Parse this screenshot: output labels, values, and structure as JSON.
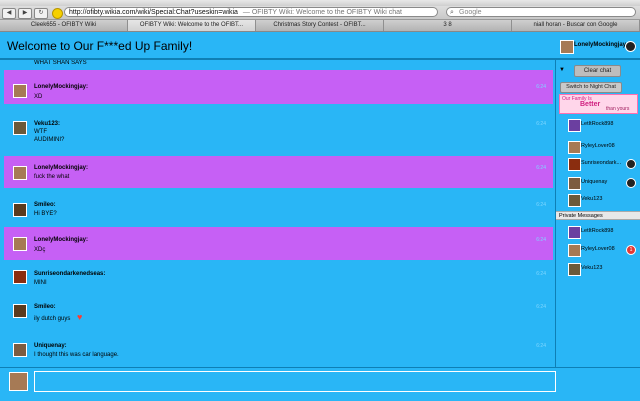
{
  "browser": {
    "url": "http://ofibty.wikia.com/wiki/Special:Chat?useskin=wikia",
    "page_title": "— OFIBTY Wiki: Welcome to the OFIBTY Wiki chat",
    "search_placeholder": "Google",
    "nav": {
      "back": "◀",
      "forward": "▶",
      "refresh": "↻",
      "stop": "+"
    },
    "tabs": [
      {
        "label": "Cleek655 - OFIBTY Wiki"
      },
      {
        "label": "OFIBTY Wiki: Welcome to the OFIBT..."
      },
      {
        "label": "Christmas Story Contest - OFIBT..."
      },
      {
        "label": "3 8"
      },
      {
        "label": "niall horan - Buscar con Google"
      }
    ]
  },
  "chat": {
    "title": "Welcome to Our F***ed Up Family!",
    "current_user": "LonelyMockingjay",
    "clear_label": "Clear chat",
    "night_label": "Switch to Night Chat",
    "ad": {
      "line1": "Our Family Is",
      "line2": "Better",
      "line3": "than yours"
    },
    "private_header": "Private Messages",
    "partial_top_line": "WHAT SHAN SAYS",
    "messages": [
      {
        "author": "LonelyMockingjay:",
        "lines": [
          "XD"
        ],
        "time": "6:24"
      },
      {
        "author": "Veku123:",
        "lines": [
          "WTF",
          "AUDIMINI?"
        ],
        "time": "6:24"
      },
      {
        "author": "LonelyMockingjay:",
        "lines": [
          "fuck the what"
        ],
        "time": "6:24"
      },
      {
        "author": "Smileo:",
        "lines": [
          "Hi BYE?"
        ],
        "time": "6:24"
      },
      {
        "author": "LonelyMockingjay:",
        "lines": [
          "XDç"
        ],
        "time": "6:24"
      },
      {
        "author": "Sunriseondarkenedseas:",
        "lines": [
          "MINI"
        ],
        "time": "6:24"
      },
      {
        "author": "Smileo:",
        "lines": [
          "ily dutch guys"
        ],
        "time": "6:24"
      },
      {
        "author": "Uniquenay:",
        "lines": [
          "I thought this was car language."
        ],
        "time": "6:24"
      }
    ],
    "users": [
      {
        "name": "LetItRock898"
      },
      {
        "name": "RyleyLover08"
      },
      {
        "name": "Sunriseondark..."
      },
      {
        "name": "Uniquenay"
      },
      {
        "name": "Veku123"
      }
    ],
    "private_users": [
      {
        "name": "LetItRock898"
      },
      {
        "name": "RyleyLover08",
        "badge": "1"
      },
      {
        "name": "Veku123"
      }
    ]
  }
}
